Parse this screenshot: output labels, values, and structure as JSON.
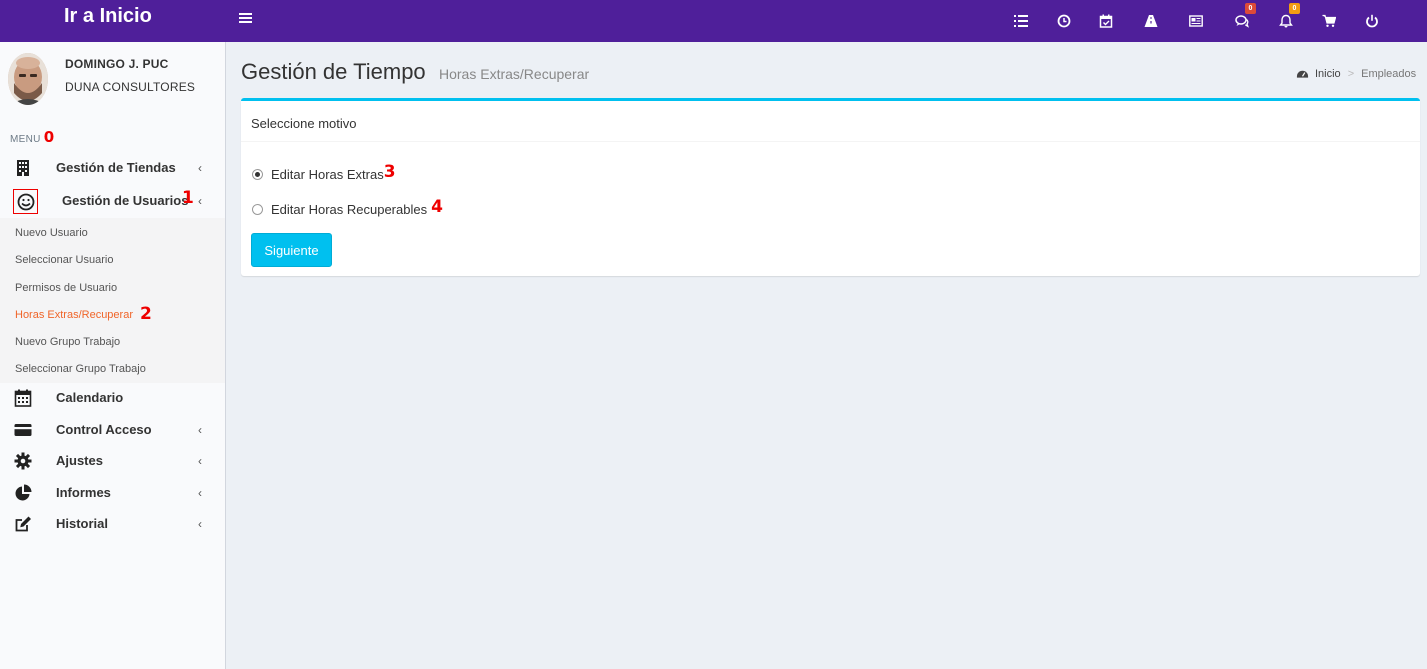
{
  "header": {
    "brand": "Ir a Inicio",
    "icons": [
      {
        "name": "list-icon"
      },
      {
        "name": "clock-icon"
      },
      {
        "name": "calendar-check-icon"
      },
      {
        "name": "road-icon"
      },
      {
        "name": "newspaper-icon"
      },
      {
        "name": "comments-icon",
        "badge": "0",
        "badge_color": "#dd4b39"
      },
      {
        "name": "bell-icon",
        "badge": "0",
        "badge_color": "#f39c12"
      },
      {
        "name": "cart-icon"
      },
      {
        "name": "power-icon"
      }
    ]
  },
  "user": {
    "name": "DOMINGO J. PUC",
    "company": "DUNA CONSULTORES"
  },
  "sidebar": {
    "menu_header": "MENU",
    "menu_header_annotation": "0",
    "items": [
      {
        "label": "Gestión de Tiendas",
        "icon": "building-icon"
      },
      {
        "label": "Gestión de Usuarios",
        "icon": "smile-icon",
        "annotation": "1"
      },
      {
        "label": "Calendario",
        "icon": "calendar-icon"
      },
      {
        "label": "Control Acceso",
        "icon": "credit-card-icon"
      },
      {
        "label": "Ajustes",
        "icon": "gear-icon"
      },
      {
        "label": "Informes",
        "icon": "pie-chart-icon"
      },
      {
        "label": "Historial",
        "icon": "edit-icon"
      }
    ],
    "submenu": [
      {
        "label": "Nuevo Usuario"
      },
      {
        "label": "Seleccionar Usuario"
      },
      {
        "label": "Permisos de Usuario"
      },
      {
        "label": "Horas Extras/Recuperar",
        "annotation": "2",
        "active": true
      },
      {
        "label": "Nuevo Grupo Trabajo"
      },
      {
        "label": "Seleccionar Grupo Trabajo"
      }
    ]
  },
  "content": {
    "title": "Gestión de Tiempo",
    "subtitle": "Horas Extras/Recuperar",
    "breadcrumb": {
      "home": "Inicio",
      "current": "Empleados"
    },
    "box_title": "Seleccione motivo",
    "options": [
      {
        "label": "Editar Horas Extras",
        "annotation": "3",
        "checked": true
      },
      {
        "label": "Editar Horas Recuperables",
        "annotation": "4",
        "checked": false
      }
    ],
    "button_label": "Siguiente"
  },
  "colors": {
    "navbar": "#4f1f9a",
    "accent": "#00c0ef",
    "active_link": "#f06529",
    "annotation": "#ee0000"
  }
}
